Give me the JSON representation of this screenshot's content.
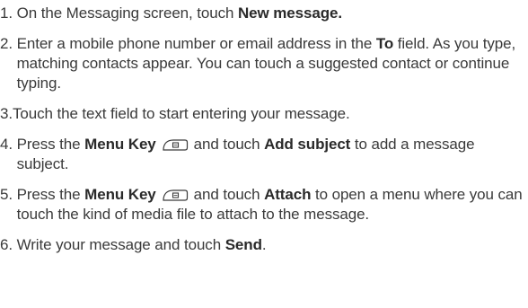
{
  "steps": [
    {
      "number": "1.",
      "parts": [
        "On the Messaging screen, touch ",
        "New message."
      ]
    },
    {
      "number": "2.",
      "parts": [
        "Enter a mobile phone number or email address in the ",
        "To",
        " field. As you type, matching contacts appear. You can touch a suggested contact or continue typing."
      ]
    },
    {
      "number": "3.",
      "parts": [
        "Touch the text field to start entering your message."
      ]
    },
    {
      "number": "4.",
      "parts": [
        "Press the ",
        "Menu Key",
        "and touch ",
        "Add subject",
        " to add a message subject."
      ]
    },
    {
      "number": "5.",
      "parts": [
        "Press the ",
        "Menu Key",
        "and touch ",
        "Attach",
        " to open a menu where you can touch the kind of media file to attach to the message."
      ]
    },
    {
      "number": "6.",
      "parts": [
        "Write your message and touch ",
        "Send",
        "."
      ]
    }
  ],
  "icons": {
    "menu_key": "menu-key-icon"
  }
}
